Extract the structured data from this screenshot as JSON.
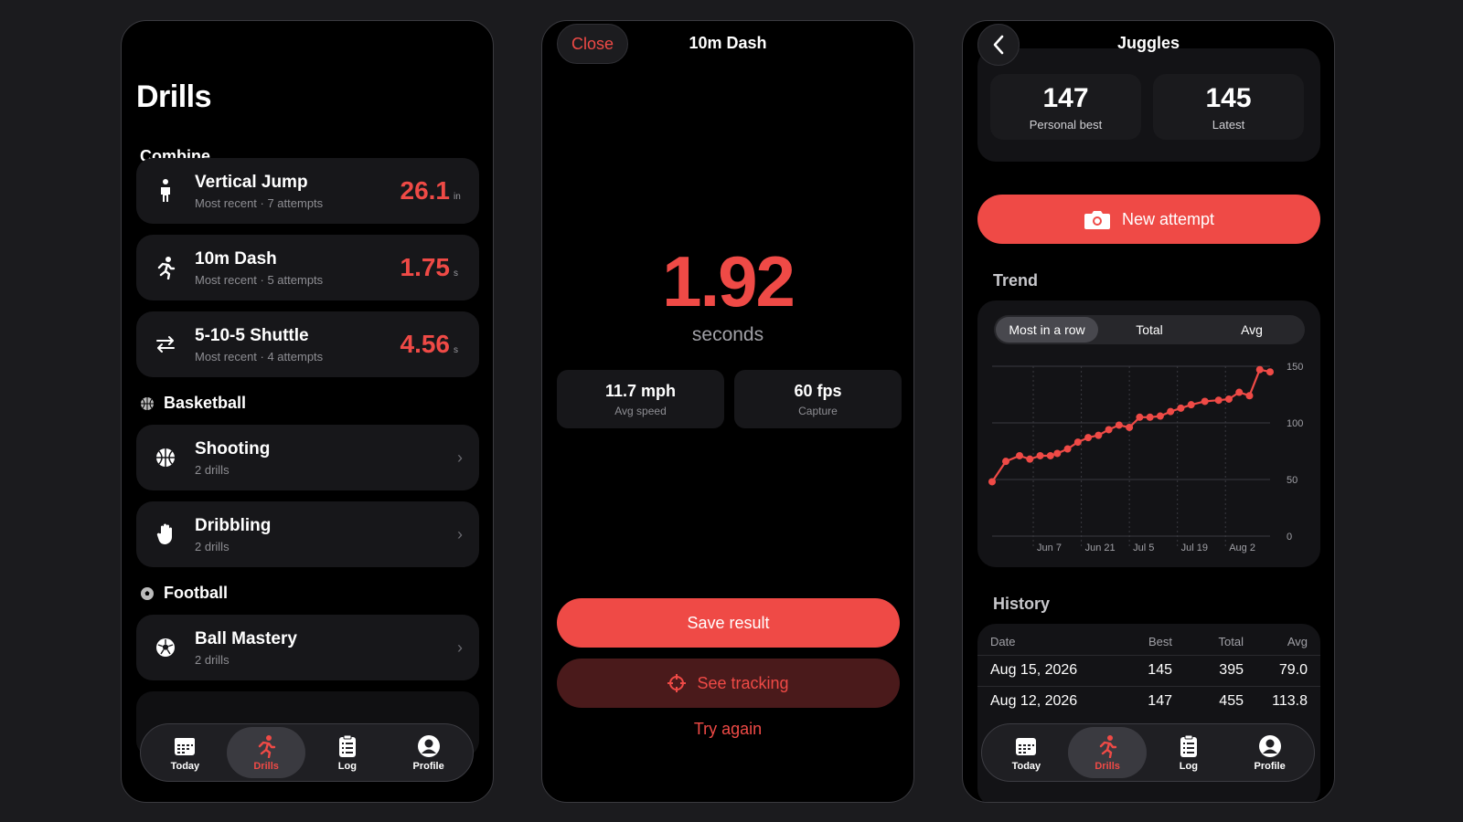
{
  "drills_screen": {
    "title": "Drills",
    "sections": {
      "combine": "Combine",
      "basketball": "Basketball",
      "football": "Football"
    },
    "combine_items": [
      {
        "title": "Vertical Jump",
        "subtitle": "Most recent · 7 attempts",
        "value": "26.1",
        "unit": "in"
      },
      {
        "title": "10m Dash",
        "subtitle": "Most recent · 5 attempts",
        "value": "1.75",
        "unit": "s"
      },
      {
        "title": "5-10-5 Shuttle",
        "subtitle": "Most recent · 4 attempts",
        "value": "4.56",
        "unit": "s"
      }
    ],
    "basketball_items": [
      {
        "title": "Shooting",
        "subtitle": "2 drills"
      },
      {
        "title": "Dribbling",
        "subtitle": "2 drills"
      }
    ],
    "football_items": [
      {
        "title": "Ball Mastery",
        "subtitle": "2 drills"
      }
    ]
  },
  "tabbar": {
    "today": "Today",
    "drills": "Drills",
    "log": "Log",
    "profile": "Profile",
    "active": "drills"
  },
  "dash_screen": {
    "close_label": "Close",
    "title": "10m Dash",
    "result_value": "1.92",
    "result_unit": "seconds",
    "stats": [
      {
        "value": "11.7 mph",
        "label": "Avg speed"
      },
      {
        "value": "60 fps",
        "label": "Capture"
      }
    ],
    "save_label": "Save result",
    "tracking_label": "See tracking",
    "retry_label": "Try again"
  },
  "juggles_screen": {
    "title": "Juggles",
    "personal_best": {
      "value": "147",
      "label": "Personal best"
    },
    "latest": {
      "value": "145",
      "label": "Latest"
    },
    "new_attempt_label": "New attempt",
    "trend_label": "Trend",
    "segments": [
      "Most in a row",
      "Total",
      "Avg"
    ],
    "active_segment": 0,
    "history_label": "History",
    "history_columns": {
      "date": "Date",
      "best": "Best",
      "total": "Total",
      "avg": "Avg"
    },
    "history_rows": [
      {
        "date": "Aug 15, 2026",
        "best": "145",
        "total": "395",
        "avg": "79.0"
      },
      {
        "date": "Aug 12, 2026",
        "best": "147",
        "total": "455",
        "avg": "113.8"
      }
    ]
  },
  "chart_data": {
    "type": "line",
    "title": "",
    "xlabel": "",
    "ylabel": "",
    "x_ticks": [
      "Jun 7",
      "Jun 21",
      "Jul 5",
      "Jul 19",
      "Aug 2"
    ],
    "y_ticks": [
      0,
      50,
      100,
      150
    ],
    "ylim": [
      0,
      150
    ],
    "grid": true,
    "series": [
      {
        "color": "#ef4a46",
        "x": [
          "2026-05-26",
          "2026-05-30",
          "2026-06-03",
          "2026-06-06",
          "2026-06-09",
          "2026-06-12",
          "2026-06-14",
          "2026-06-17",
          "2026-06-20",
          "2026-06-23",
          "2026-06-26",
          "2026-06-29",
          "2026-07-02",
          "2026-07-05",
          "2026-07-08",
          "2026-07-11",
          "2026-07-14",
          "2026-07-17",
          "2026-07-20",
          "2026-07-23",
          "2026-07-27",
          "2026-07-31",
          "2026-08-03",
          "2026-08-06",
          "2026-08-09",
          "2026-08-12",
          "2026-08-15"
        ],
        "values": [
          48,
          66,
          71,
          68,
          71,
          71,
          73,
          77,
          83,
          87,
          89,
          94,
          98,
          96,
          105,
          105,
          106,
          110,
          113,
          116,
          119,
          120,
          121,
          127,
          124,
          147,
          145
        ]
      }
    ],
    "colors": {
      "line": "#ef4a46",
      "grid": "#3a3a40",
      "accent": "#ef4a46"
    }
  }
}
